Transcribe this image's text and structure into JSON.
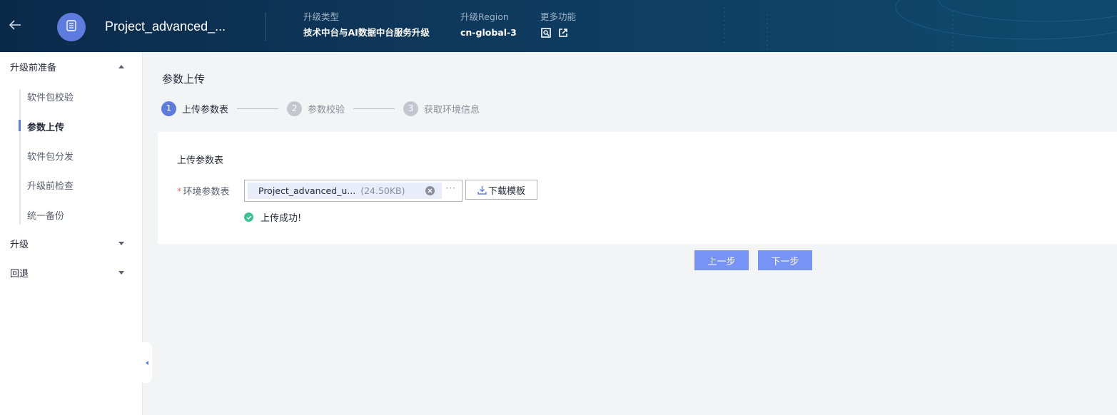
{
  "header": {
    "project_title": "Project_advanced_...",
    "fields": [
      {
        "label": "升级类型",
        "value": "技术中台与AI数据中台服务升级"
      },
      {
        "label": "升级Region",
        "value": "cn-global-3"
      },
      {
        "label": "更多功能"
      }
    ],
    "icons": [
      "back-arrow-icon",
      "document-icon",
      "search-report-icon",
      "external-link-icon"
    ]
  },
  "sidebar": {
    "groups": [
      {
        "label": "升级前准备",
        "expanded": true
      },
      {
        "label": "升级",
        "expanded": false
      },
      {
        "label": "回退",
        "expanded": false
      }
    ],
    "sub_items": [
      {
        "label": "软件包校验"
      },
      {
        "label": "参数上传",
        "active": true
      },
      {
        "label": "软件包分发"
      },
      {
        "label": "升级前检查"
      },
      {
        "label": "统一备份"
      }
    ]
  },
  "main": {
    "page_title": "参数上传",
    "steps": [
      {
        "num": "1",
        "label": "上传参数表",
        "active": true
      },
      {
        "num": "2",
        "label": "参数校验",
        "active": false
      },
      {
        "num": "3",
        "label": "获取环境信息",
        "active": false
      }
    ],
    "card": {
      "title": "上传参数表",
      "field_required_mark": "*",
      "field_label": "环境参数表",
      "file_name": "Project_advanced_u...",
      "file_size": "(24.50KB)",
      "more": "···",
      "download_label": "下载模板",
      "success_text": "上传成功!"
    },
    "prev_button": "上一步",
    "next_button": "下一步"
  },
  "colors": {
    "accent": "#5e7ce0",
    "button": "#7693f5",
    "success": "#3ac295",
    "required": "#f66f6a",
    "header_bg": "#0e3a5e"
  }
}
